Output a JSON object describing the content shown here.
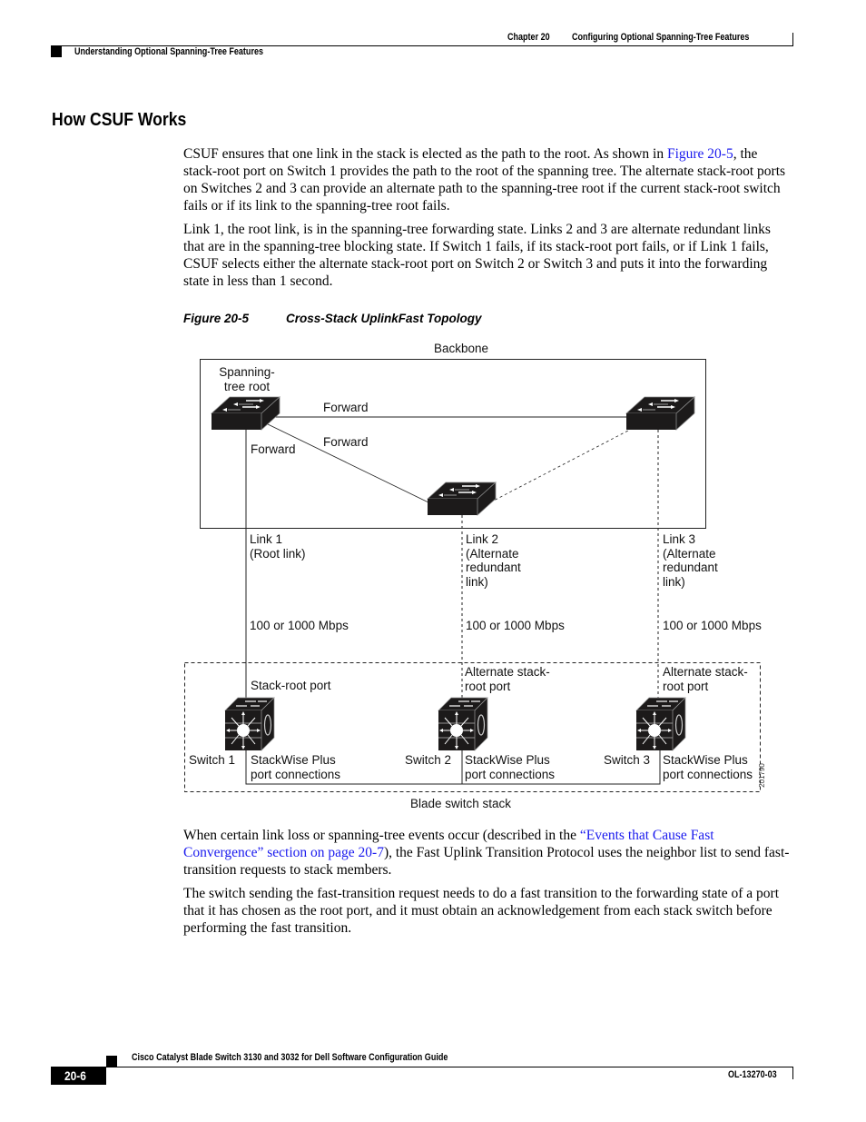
{
  "header": {
    "chapter": "Chapter 20",
    "chapter_title": "Configuring Optional Spanning-Tree Features",
    "section_running": "Understanding Optional Spanning-Tree Features"
  },
  "section_title": "How CSUF Works",
  "paragraphs": {
    "p1_before": "CSUF ensures that one link in the stack is elected as the path to the root. As shown in ",
    "p1_link": "Figure 20-5",
    "p1_after": ", the stack-root port on Switch 1 provides the path to the root of the spanning tree. The alternate stack-root ports on Switches 2 and 3 can provide an alternate path to the spanning-tree root if the current stack-root switch fails or if its link to the spanning-tree root fails.",
    "p2": "Link 1, the root link, is in the spanning-tree forwarding state. Links 2 and 3 are alternate redundant links that are in the spanning-tree blocking state. If Switch 1 fails, if its stack-root port fails, or if Link 1 fails, CSUF selects either the alternate stack-root port on Switch 2 or Switch 3 and puts it into the forwarding state in less than 1 second.",
    "p3_before": "When certain link loss or spanning-tree events occur (described in the ",
    "p3_link": "“Events that Cause Fast Convergence” section on page 20-7",
    "p3_after": "), the Fast Uplink Transition Protocol uses the neighbor list to send fast-transition requests to stack members.",
    "p4": "The switch sending the fast-transition request needs to do a fast transition to the forwarding state of a port that it has chosen as the root port, and it must obtain an acknowledgement from each stack switch before performing the fast transition."
  },
  "figure": {
    "number": "Figure 20-5",
    "caption": "Cross-Stack UplinkFast Topology",
    "backbone_label": "Backbone",
    "root_label_1": "Spanning-",
    "root_label_2": "tree root",
    "forward_top": "Forward",
    "forward_diag": "Forward",
    "forward_down": "Forward",
    "links": [
      {
        "lines": [
          "Link 1",
          "(Root link)"
        ],
        "speed": "100 or 1000 Mbps"
      },
      {
        "lines": [
          "Link 2",
          "(Alternate",
          "redundant",
          "link)"
        ],
        "speed": "100 or 1000 Mbps"
      },
      {
        "lines": [
          "Link 3",
          "(Alternate",
          "redundant",
          "link)"
        ],
        "speed": "100 or 1000 Mbps"
      }
    ],
    "port_labels": [
      {
        "lines": [
          "Stack-root port"
        ]
      },
      {
        "lines": [
          "Alternate stack-",
          "root port"
        ]
      },
      {
        "lines": [
          "Alternate stack-",
          "root port"
        ]
      }
    ],
    "switches": [
      {
        "name": "Switch 1",
        "conn_1": "StackWise Plus",
        "conn_2": "port connections"
      },
      {
        "name": "Switch 2",
        "conn_1": "StackWise Plus",
        "conn_2": "port connections"
      },
      {
        "name": "Switch 3",
        "conn_1": "StackWise Plus",
        "conn_2": "port connections"
      }
    ],
    "stack_label": "Blade switch stack",
    "figure_id": "201790"
  },
  "footer": {
    "guide_title": "Cisco Catalyst Blade Switch 3130 and 3032 for Dell Software Configuration Guide",
    "page_number": "20-6",
    "doc_number": "OL-13270-03"
  }
}
